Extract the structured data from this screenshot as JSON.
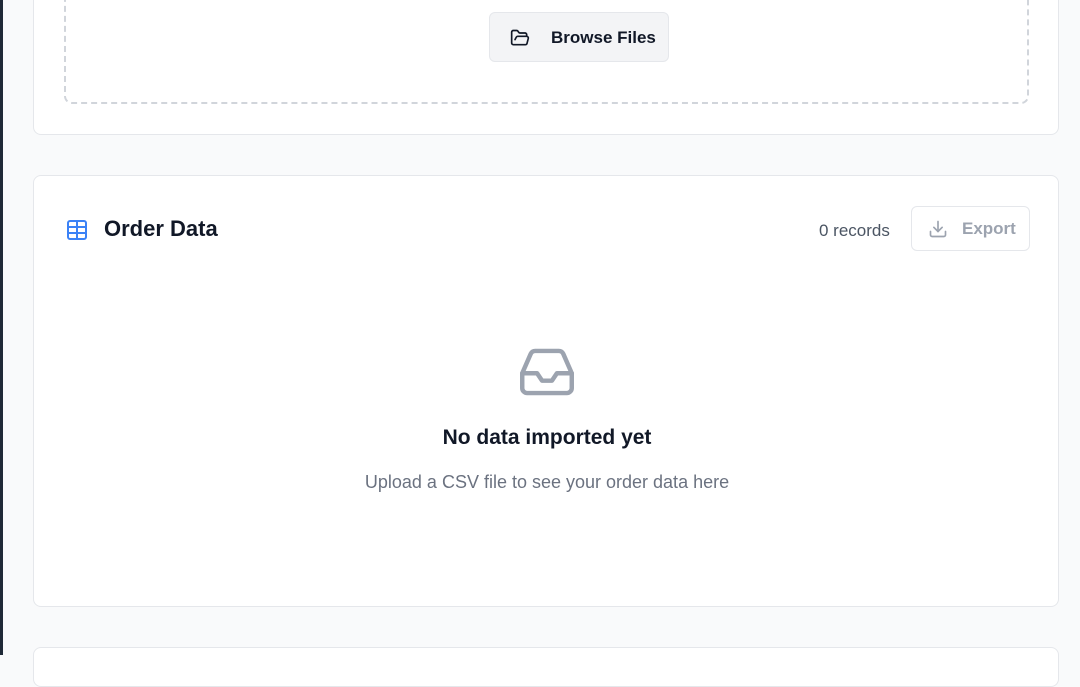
{
  "upload": {
    "browse_label": "Browse Files"
  },
  "order_data": {
    "title": "Order Data",
    "records": "0 records",
    "export_label": "Export",
    "empty_title": "No data imported yet",
    "empty_subtitle": "Upload a CSV file to see your order data here"
  },
  "icons": {
    "browse": "folder-open-icon",
    "table": "table-icon",
    "export": "download-icon",
    "empty": "inbox-icon"
  },
  "colors": {
    "accent": "#3b82f6",
    "muted": "#9ca3af"
  }
}
